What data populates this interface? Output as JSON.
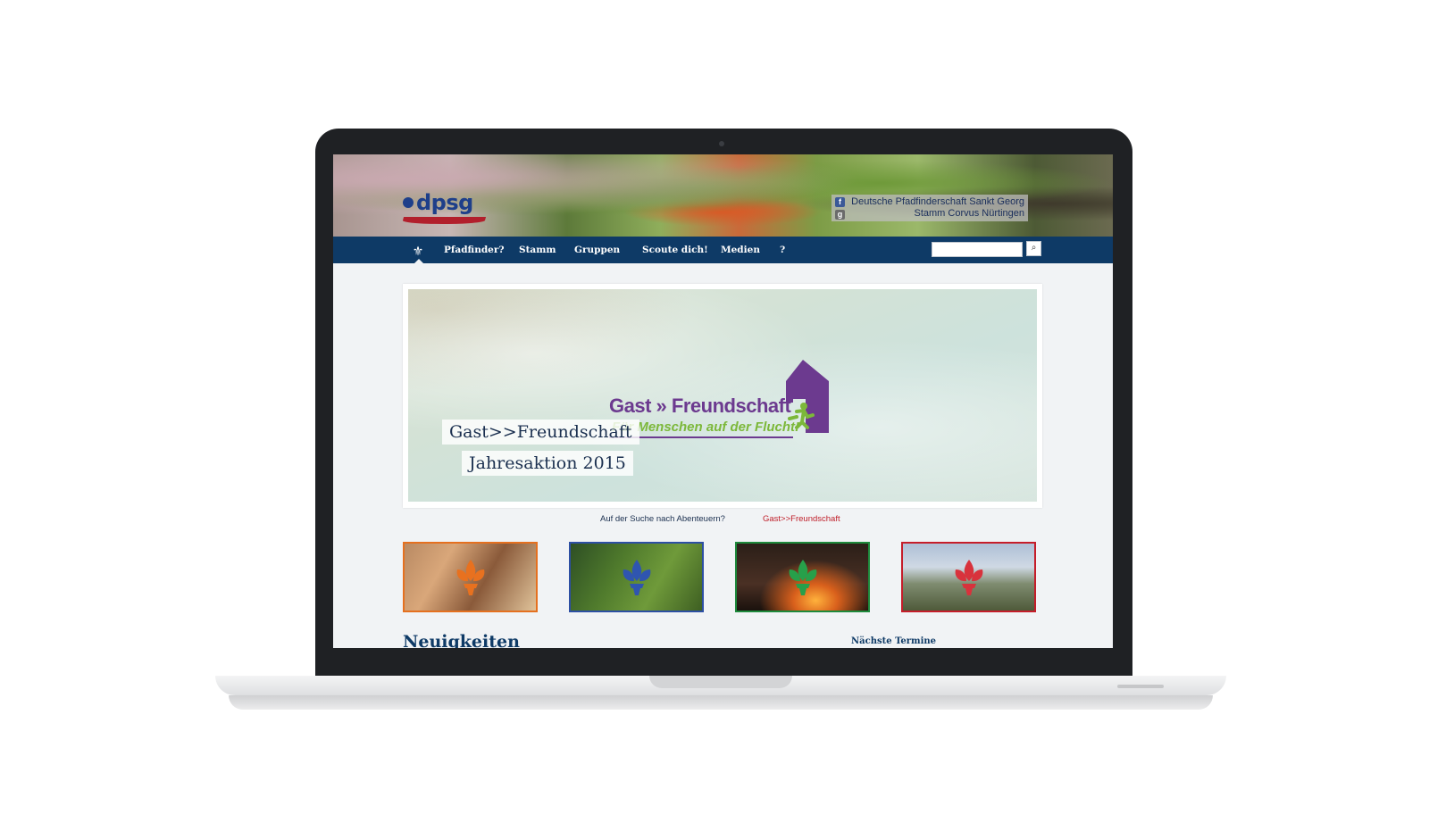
{
  "header": {
    "logo_text": "dpsg",
    "org_name": "Deutsche Pfadfinderschaft Sankt Georg",
    "org_unit": "Stamm Corvus Nürtingen"
  },
  "nav": {
    "items": [
      {
        "label": "Pfadfinder?"
      },
      {
        "label": "Stamm"
      },
      {
        "label": "Gruppen"
      },
      {
        "label": "Scoute dich!"
      },
      {
        "label": "Medien"
      },
      {
        "label": "?"
      }
    ],
    "search_placeholder": ""
  },
  "hero": {
    "campaign_title_left": "Gast",
    "campaign_title_sep": "»",
    "campaign_title_right": "Freundschaft",
    "campaign_subtitle": "Für Menschen auf der Flucht!",
    "caption_1": "Gast>>Freundschaft",
    "caption_2": "Jahresaktion 2015"
  },
  "slider_links": [
    {
      "label": "Auf der Suche nach Abenteuern?"
    },
    {
      "label": "Gast>>Freundschaft"
    }
  ],
  "thumbnails": [
    {
      "lily_color": "#e8711f",
      "border_color": "#e5701f"
    },
    {
      "lily_color": "#2f55b0",
      "border_color": "#2d4fa3"
    },
    {
      "lily_color": "#27a04a",
      "border_color": "#1e8a3c"
    },
    {
      "lily_color": "#d8323c",
      "border_color": "#c51d2a"
    }
  ],
  "sections": {
    "news_heading": "Neuigkeiten",
    "events_heading": "Nächste Termine"
  },
  "colors": {
    "nav_bg": "#0e3a66",
    "accent_red": "#c0202b",
    "campaign_purple": "#6c3a8f",
    "campaign_green": "#7cb83a"
  }
}
